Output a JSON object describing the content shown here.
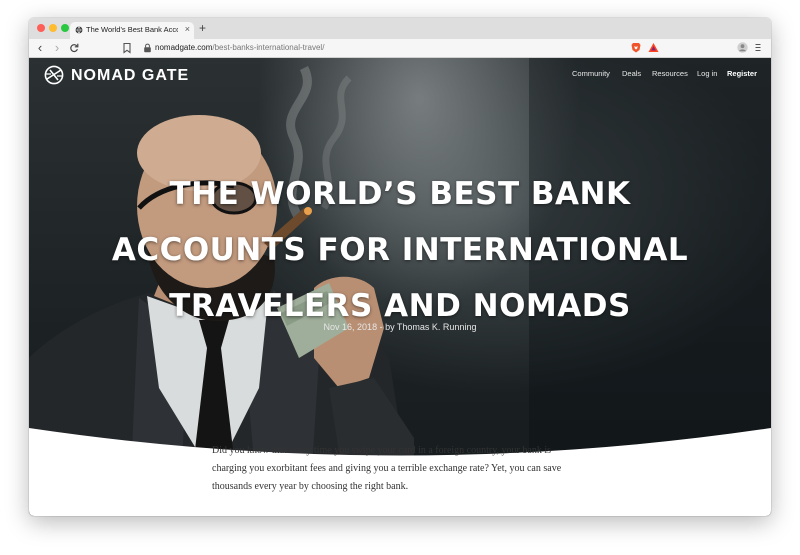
{
  "browser": {
    "tab_title": "The World's Best Bank Account",
    "tab_close": "×",
    "new_tab": "+",
    "url_domain": "nomadgate.com",
    "url_path": "/best-banks-international-travel/",
    "nav": {
      "back": "‹",
      "forward": "›",
      "reload": "C"
    }
  },
  "site": {
    "logo_text": "NOMAD GATE",
    "nav": [
      "Community",
      "Deals",
      "Resources",
      "Log in",
      "Register"
    ]
  },
  "hero": {
    "headline": "THE WORLD’S BEST BANK ACCOUNTS FOR INTERNATIONAL TRAVELERS AND NOMADS",
    "byline": "Nov 16, 2018 - by Thomas K. Running"
  },
  "article": {
    "intro": "Did you know that every time you swipe your card in a foreign country, your bank is charging you exorbitant fees and giving you a terrible exchange rate? Yet, you can save thousands every year by choosing the right bank."
  },
  "colors": {
    "hero_dark": "#1c2224",
    "text_white": "#ffffff",
    "body_text": "#333333"
  },
  "icons": [
    "globe-icon",
    "bookmark-icon",
    "lock-icon",
    "brave-lion-icon",
    "bat-rewards-icon",
    "profile-icon",
    "menu-dots-icon",
    "nomad-gate-logo-icon"
  ]
}
